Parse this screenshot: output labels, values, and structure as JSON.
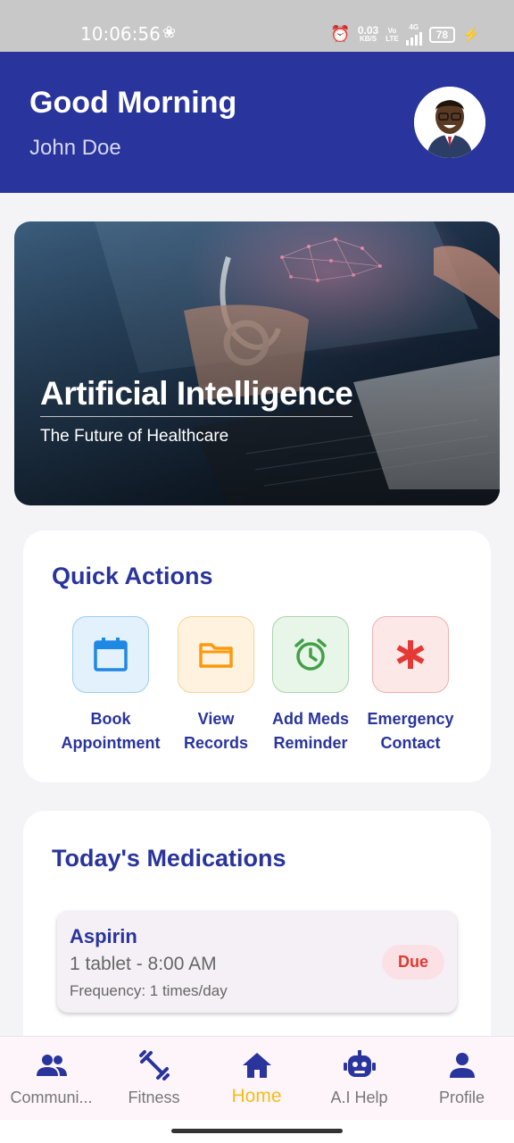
{
  "status_bar": {
    "time": "10:06:56",
    "net_speed": "0.03",
    "net_unit": "KB/S",
    "volte_top": "Vo",
    "volte_bottom": "LTE",
    "network": "4G",
    "battery": "78"
  },
  "header": {
    "greeting": "Good Morning",
    "username": "John Doe",
    "avatar_icon": "avatar"
  },
  "banner": {
    "title": "Artificial Intelligence",
    "subtitle": "The Future of Healthcare"
  },
  "quick_actions": {
    "title": "Quick Actions",
    "items": [
      {
        "line1": "Book",
        "line2": "Appointment",
        "icon": "calendar-icon",
        "color": "#1e88e5",
        "bg": "#e3f1fd",
        "border": "#9fcbf2"
      },
      {
        "line1": "View",
        "line2": "Records",
        "icon": "folder-icon",
        "color": "#fb9a0e",
        "bg": "#fff3e0",
        "border": "#f7d29a"
      },
      {
        "line1": "Add Meds",
        "line2": "Reminder",
        "icon": "alarm-clock-icon",
        "color": "#43a047",
        "bg": "#e8f5e9",
        "border": "#aad4ab"
      },
      {
        "line1": "Emergency",
        "line2": "Contact",
        "icon": "asterisk-icon",
        "color": "#e53935",
        "bg": "#fde8e8",
        "border": "#f0b0b0"
      }
    ]
  },
  "medications": {
    "title": "Today's Medications",
    "items": [
      {
        "name": "Aspirin",
        "dose": "1 tablet - 8:00 AM",
        "frequency": "Frequency: 1 times/day",
        "status": "Due"
      }
    ]
  },
  "bottom_nav": {
    "items": [
      {
        "label": "Communi...",
        "icon": "people-icon"
      },
      {
        "label": "Fitness",
        "icon": "dumbbell-icon"
      },
      {
        "label": "Home",
        "icon": "home-icon",
        "active": true
      },
      {
        "label": "A.I Help",
        "icon": "robot-icon"
      },
      {
        "label": "Profile",
        "icon": "person-icon"
      }
    ],
    "active_color": "#f5bd19"
  },
  "colors": {
    "primary": "#29349c",
    "due": "#e03a2f"
  }
}
